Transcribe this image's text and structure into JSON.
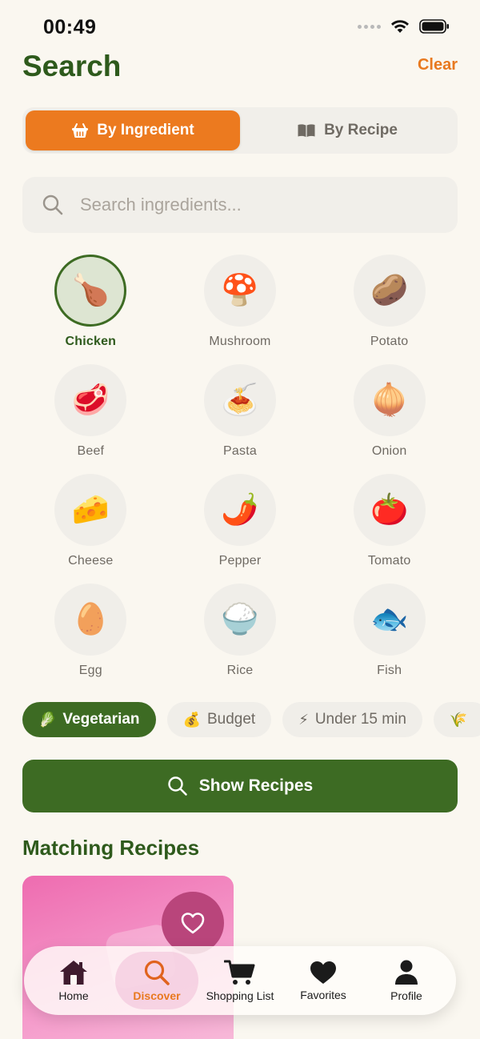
{
  "status": {
    "time": "00:49"
  },
  "header": {
    "title": "Search",
    "clear_label": "Clear"
  },
  "segments": [
    {
      "label": "By Ingredient",
      "icon": "basket-icon",
      "active": true
    },
    {
      "label": "By Recipe",
      "icon": "book-icon",
      "active": false
    }
  ],
  "search": {
    "placeholder": "Search ingredients..."
  },
  "ingredients": [
    {
      "label": "Chicken",
      "emoji": "🍗",
      "selected": true
    },
    {
      "label": "Mushroom",
      "emoji": "🍄",
      "selected": false
    },
    {
      "label": "Potato",
      "emoji": "🥔",
      "selected": false
    },
    {
      "label": "Beef",
      "emoji": "🥩",
      "selected": false
    },
    {
      "label": "Pasta",
      "emoji": "🍝",
      "selected": false
    },
    {
      "label": "Onion",
      "emoji": "🧅",
      "selected": false
    },
    {
      "label": "Cheese",
      "emoji": "🧀",
      "selected": false
    },
    {
      "label": "Pepper",
      "emoji": "🌶️",
      "selected": false
    },
    {
      "label": "Tomato",
      "emoji": "🍅",
      "selected": false
    },
    {
      "label": "Egg",
      "emoji": "🥚",
      "selected": false
    },
    {
      "label": "Rice",
      "emoji": "🍚",
      "selected": false
    },
    {
      "label": "Fish",
      "emoji": "🐟",
      "selected": false
    }
  ],
  "chips": [
    {
      "label": "Vegetarian",
      "emoji": "🥬",
      "active": true
    },
    {
      "label": "Budget",
      "emoji": "💰",
      "active": false
    },
    {
      "label": "Under 15 min",
      "emoji": "⚡",
      "active": false
    },
    {
      "label": "",
      "emoji": "🌾",
      "active": false
    }
  ],
  "show_button": {
    "label": "Show Recipes"
  },
  "matching": {
    "title": "Matching Recipes"
  },
  "tabs": [
    {
      "label": "Home",
      "icon": "home-icon",
      "active": false
    },
    {
      "label": "Discover",
      "icon": "search-icon",
      "active": true
    },
    {
      "label": "Shopping List",
      "icon": "cart-icon",
      "active": false
    },
    {
      "label": "Favorites",
      "icon": "heart-icon",
      "active": false
    },
    {
      "label": "Profile",
      "icon": "person-icon",
      "active": false
    }
  ],
  "colors": {
    "primary_green": "#3D6B23",
    "title_green": "#2E5A1C",
    "accent_orange": "#EC7A1F",
    "background": "#FAF7F0"
  }
}
